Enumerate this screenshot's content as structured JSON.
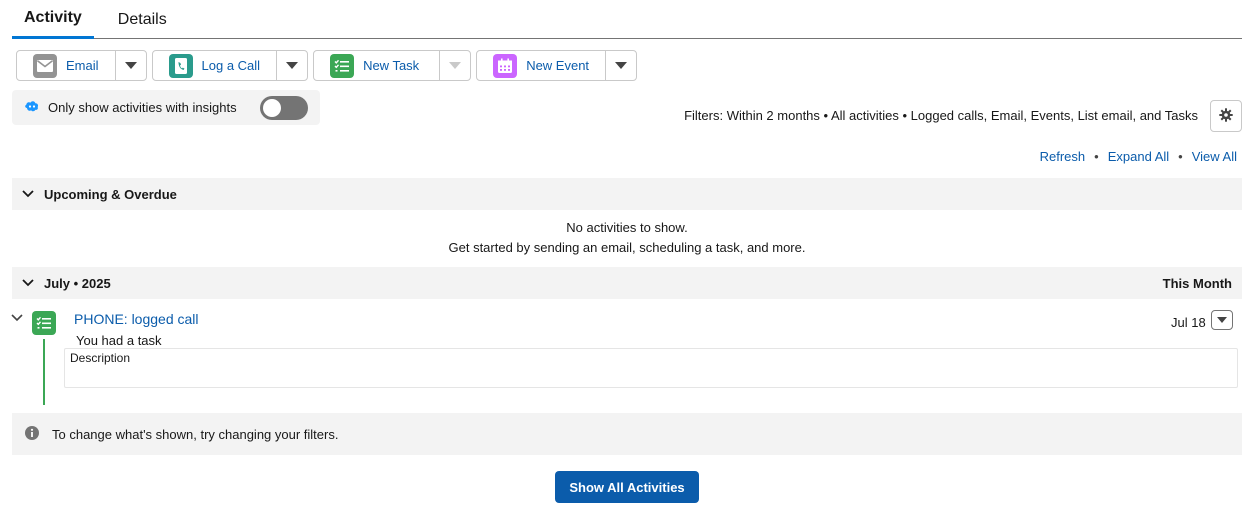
{
  "tabs": [
    {
      "label": "Activity"
    },
    {
      "label": "Details"
    }
  ],
  "actions": {
    "email": "Email",
    "log_call": "Log a Call",
    "new_task": "New Task",
    "new_event": "New Event"
  },
  "insights": {
    "label": "Only show activities with insights",
    "toggle_on": false
  },
  "filters_text": "Filters: Within 2 months • All activities • Logged calls, Email, Events, List email, and Tasks",
  "links": {
    "refresh": "Refresh",
    "expand_all": "Expand All",
    "view_all": "View All",
    "separator": "•"
  },
  "upcoming": {
    "title": "Upcoming & Overdue",
    "empty_line1": "No activities to show.",
    "empty_line2": "Get started by sending an email, scheduling a task, and more."
  },
  "month": {
    "title": "July • 2025",
    "right_label": "This Month"
  },
  "timeline_item": {
    "title": "PHONE: logged call",
    "subtitle": "You had a task",
    "date": "Jul 18",
    "description_label": "Description"
  },
  "info_text": "To change what's shown, try changing your filters.",
  "show_all_button": "Show All Activities",
  "colors": {
    "brand_blue": "#0b5cab",
    "tab_underline": "#0176d3",
    "email_icon": "#939393",
    "call_icon": "#2a9b8c",
    "task_icon": "#3ba755",
    "event_icon": "#cb65ff"
  }
}
